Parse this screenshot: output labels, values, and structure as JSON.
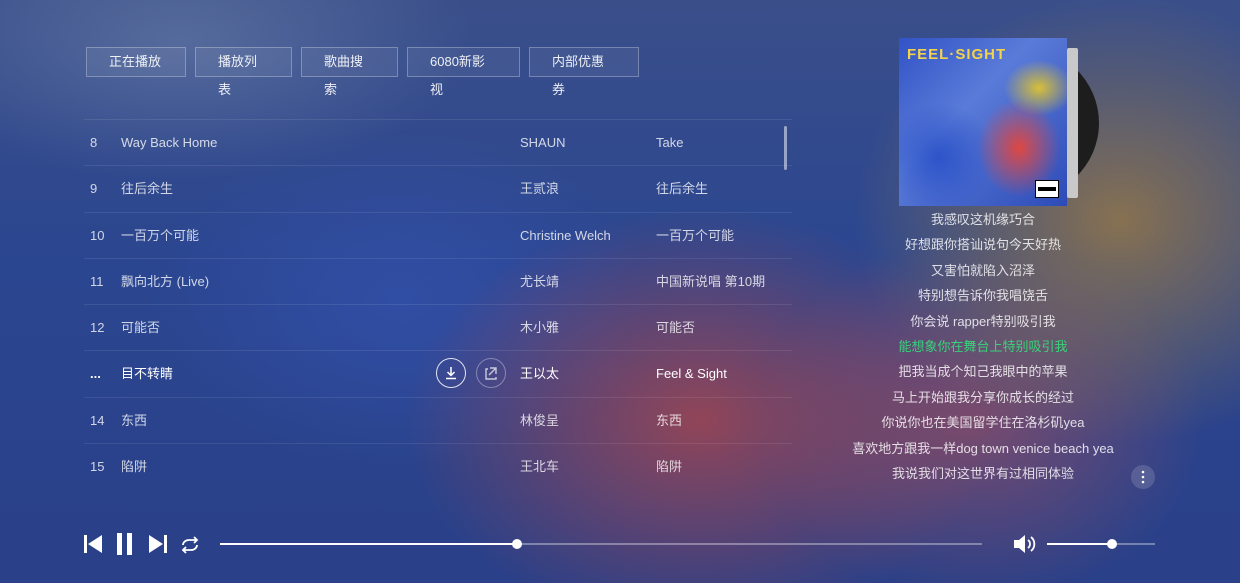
{
  "tabs": [
    "正在播放",
    "播放列表",
    "歌曲搜索",
    "6080新影视",
    "内部优惠券"
  ],
  "songs": [
    {
      "num": "8",
      "title": "Way Back Home",
      "artist": "SHAUN",
      "album": "Take"
    },
    {
      "num": "9",
      "title": "往后余生",
      "artist": "王贰浪",
      "album": "往后余生"
    },
    {
      "num": "10",
      "title": "一百万个可能",
      "artist": "Christine Welch",
      "album": "一百万个可能"
    },
    {
      "num": "11",
      "title": "飘向北方 (Live)",
      "artist": "尤长靖",
      "album": "中国新说唱 第10期"
    },
    {
      "num": "12",
      "title": "可能否",
      "artist": "木小雅",
      "album": "可能否"
    },
    {
      "num": "...",
      "title": "目不转睛",
      "artist": "王以太",
      "album": "Feel & Sight"
    },
    {
      "num": "14",
      "title": "东西",
      "artist": "林俊呈",
      "album": "东西"
    },
    {
      "num": "15",
      "title": "陷阱",
      "artist": "王北车",
      "album": "陷阱"
    }
  ],
  "active_index": 5,
  "album_art": {
    "cover_text": "FEEL·SIGHT"
  },
  "lyrics": [
    "我感叹这机缘巧合",
    "好想跟你搭讪说句今天好热",
    "又害怕就陷入沼泽",
    "特别想告诉你我唱饶舌",
    "你会说 rapper特别吸引我",
    "能想象你在舞台上特别吸引我",
    "把我当成个知己我眼中的苹果",
    "马上开始跟我分享你成长的经过",
    "你说你也在美国留学住在洛杉矶yea",
    "喜欢地方跟我一样dog town venice beach yea",
    "我说我们对这世界有过相同体验"
  ],
  "current_lyric_index": 5,
  "player": {
    "progress": 0.39,
    "volume": 0.6
  },
  "colors": {
    "accent_lyric": "#39d27a"
  },
  "icons": [
    "previous-icon",
    "pause-icon",
    "next-icon",
    "repeat-icon",
    "download-icon",
    "share-icon",
    "volume-icon",
    "more-icon"
  ]
}
